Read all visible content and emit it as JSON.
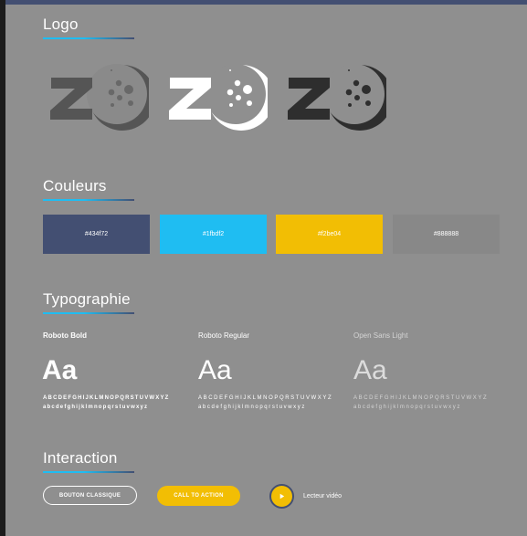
{
  "sections": {
    "logo": {
      "title": "Logo"
    },
    "colors": {
      "title": "Couleurs",
      "swatches": [
        {
          "label": "#434f72",
          "color": "#434f72"
        },
        {
          "label": "#1fbdf2",
          "color": "#1fbdf2"
        },
        {
          "label": "#f2be04",
          "color": "#f2be04"
        },
        {
          "label": "#888888",
          "color": "#888888"
        }
      ]
    },
    "typography": {
      "title": "Typographie",
      "fonts": [
        {
          "name": "Roboto Bold",
          "sample": "Aa",
          "upper": "ABCDEFGHIJKLMNOPQRSTUVWXYZ",
          "lower": "abcdefghijklmnopqrstuvwxyz"
        },
        {
          "name": "Roboto Regular",
          "sample": "Aa",
          "upper": "ABCDEFGHIJKLMNOPQRSTUVWXYZ",
          "lower": "abcdefghijklmnopqrstuvwxyz"
        },
        {
          "name": "Open Sans Light",
          "sample": "Aa",
          "upper": "ABCDEFGHIJKLMNOPQRSTUVWXYZ",
          "lower": "abcdefghijklmnopqrstuvwxyz"
        }
      ]
    },
    "interaction": {
      "title": "Interaction",
      "classic_button": "BOUTON CLASSIQUE",
      "cta_button": "CALL TO ACTION",
      "video_label": "Lecteur vidéo"
    }
  },
  "colors": {
    "background": "#8f8f8f",
    "primary": "#434f72",
    "accent": "#1fbdf2",
    "highlight": "#f2be04",
    "neutral": "#888888"
  },
  "icons": {
    "logo_variants": [
      "logo-grey-icon",
      "logo-white-icon",
      "logo-dark-icon"
    ],
    "play": "play-icon"
  }
}
